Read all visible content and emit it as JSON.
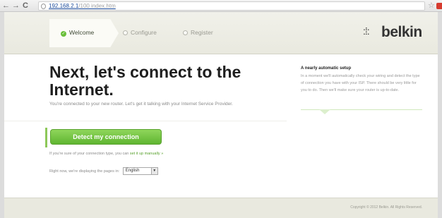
{
  "browser": {
    "back_glyph": "←",
    "forward_glyph": "→",
    "reload_glyph": "C",
    "url_host": "192.168.2.1",
    "url_path": "/100 index.htm",
    "star_glyph": "☆"
  },
  "header": {
    "tabs": [
      {
        "label": "Welcome",
        "state": "active"
      },
      {
        "label": "Configure",
        "state": "inactive"
      },
      {
        "label": "Register",
        "state": "inactive"
      }
    ],
    "check_glyph": "✓",
    "logo_mark": ":⁞:",
    "logo_text": "belkin"
  },
  "main": {
    "headline": "Next, let's connect to the Internet.",
    "subtext": "You're connected to your new router. Let's get it talking with your Internet Service Provider.",
    "cta_label": "Detect my connection",
    "manual_prefix": "If you're sure of your connection type, you can",
    "manual_link": "set it up manually »",
    "language_prefix": "Right now, we're displaying the pages in:",
    "language_selected": "English",
    "select_arrow_glyph": "▼"
  },
  "sidebar": {
    "title": "A nearly automatic setup",
    "body": "In a moment we'll automatically check your wiring and detect the type of connection you have with your ISP. There should be very little for you to do. Then we'll make sure your router is up-to-date."
  },
  "footer": {
    "copyright": "Copyright © 2012 Belkin. All Rights Reserved."
  },
  "colors": {
    "accent_green": "#6abf3a",
    "button_green": "#5fb531"
  }
}
